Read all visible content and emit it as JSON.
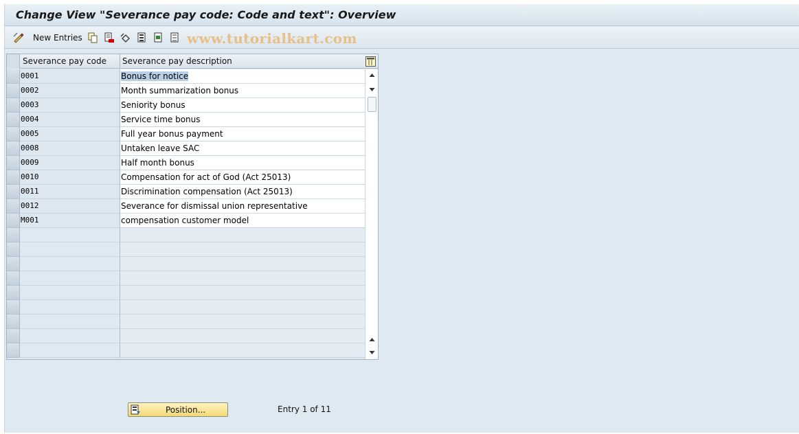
{
  "window": {
    "title": "Change View \"Severance pay code: Code and text\": Overview"
  },
  "toolbar": {
    "new_entries_label": "New Entries",
    "watermark": "www.tutorialkart.com",
    "icons": [
      "edit-icon",
      "copy-icon",
      "delete-icon",
      "undo-icon",
      "select-all-icon",
      "select-block-icon",
      "deselect-all-icon"
    ]
  },
  "table": {
    "columns": [
      "Severance pay code",
      "Severance pay description"
    ],
    "rows": [
      {
        "code": "0001",
        "description": "Bonus for notice"
      },
      {
        "code": "0002",
        "description": "Month summarization bonus"
      },
      {
        "code": "0003",
        "description": "Seniority bonus"
      },
      {
        "code": "0004",
        "description": "Service time bonus"
      },
      {
        "code": "0005",
        "description": "Full year  bonus payment"
      },
      {
        "code": "0008",
        "description": "Untaken leave SAC"
      },
      {
        "code": "0009",
        "description": "Half month bonus"
      },
      {
        "code": "0010",
        "description": "Compensation for act of God (Act 25013)"
      },
      {
        "code": "0011",
        "description": "Discrimination compensation (Act 25013)"
      },
      {
        "code": "0012",
        "description": "Severance for dismissal union representative"
      },
      {
        "code": "M001",
        "description": "compensation customer model"
      }
    ],
    "empty_rows": 9
  },
  "footer": {
    "position_label": "Position...",
    "entry_info": "Entry 1 of 11"
  },
  "colors": {
    "highlight": "#b9cfe6",
    "position_button": "#f2d977"
  }
}
